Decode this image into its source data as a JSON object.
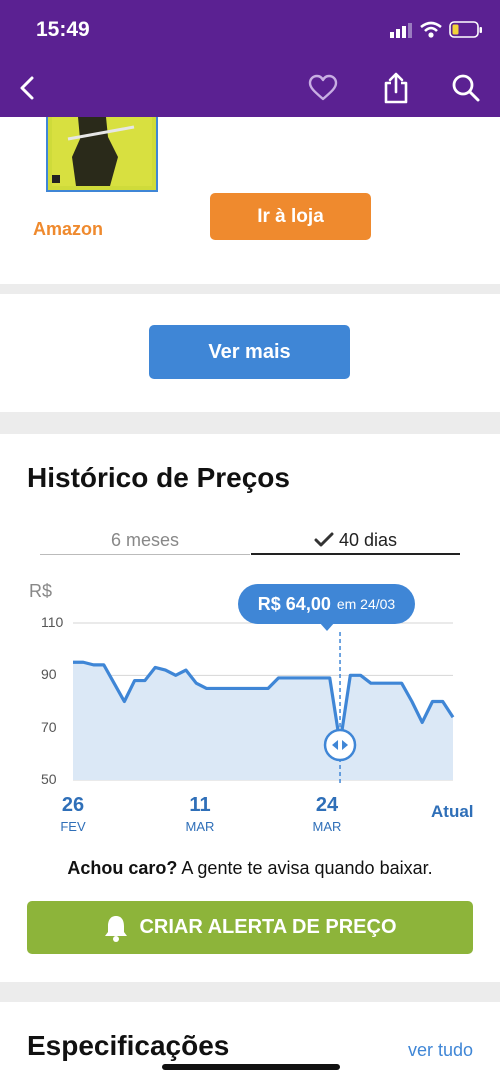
{
  "status_bar": {
    "time": "15:49"
  },
  "navbar": {
    "icons": [
      "back-icon",
      "heart-icon",
      "share-icon",
      "search-icon"
    ]
  },
  "store": {
    "name": "Amazon",
    "button_label": "Ir à loja"
  },
  "more": {
    "button_label": "Ver mais"
  },
  "history": {
    "title": "Histórico de Preços",
    "tabs": [
      {
        "label": "6 meses",
        "selected": false
      },
      {
        "label": "40 dias",
        "selected": true
      }
    ],
    "tooltip": {
      "price": "R$ 64,00",
      "date_text": "em 24/03"
    },
    "currency_label": "R$",
    "x_labels": [
      {
        "day": "26",
        "month": "FEV"
      },
      {
        "day": "11",
        "month": "MAR"
      },
      {
        "day": "24",
        "month": "MAR"
      },
      {
        "day": "Atual",
        "month": ""
      }
    ]
  },
  "chart_data": {
    "type": "area",
    "ylabel": "R$",
    "ylim": [
      50,
      110
    ],
    "yticks": [
      110,
      90,
      70,
      50
    ],
    "grid": true,
    "x": [
      "26/02",
      "27/02",
      "28/02",
      "01/03",
      "02/03",
      "03/03",
      "04/03",
      "05/03",
      "06/03",
      "07/03",
      "08/03",
      "09/03",
      "10/03",
      "11/03",
      "12/03",
      "13/03",
      "14/03",
      "15/03",
      "16/03",
      "17/03",
      "18/03",
      "19/03",
      "20/03",
      "21/03",
      "22/03",
      "23/03",
      "24/03",
      "25/03",
      "26/03",
      "27/03",
      "28/03",
      "29/03",
      "30/03",
      "31/03",
      "01/04",
      "02/04",
      "03/04",
      "04/04"
    ],
    "series": [
      {
        "values": [
          95,
          95,
          94,
          94,
          87,
          80,
          88,
          88,
          93,
          92,
          90,
          92,
          87,
          85,
          85,
          85,
          85,
          85,
          85,
          85,
          89,
          89,
          89,
          89,
          89,
          89,
          64,
          90,
          90,
          87,
          87,
          87,
          87,
          80,
          72,
          80,
          80,
          74
        ]
      }
    ],
    "highlight": {
      "x": "24/03",
      "value": 64
    }
  },
  "alert": {
    "bold": "Achou caro?",
    "rest": "A gente te avisa quando baixar.",
    "button_label": "CRIAR ALERTA DE PREÇO"
  },
  "specs": {
    "title": "Especificações",
    "link_label": "ver tudo"
  },
  "colors": {
    "header": "#5b2192",
    "store_button": "#ef8a2e",
    "amazon_text": "#ef8a2e",
    "primary_button": "#3f86d6",
    "alert_button": "#8db43a",
    "chart_line": "#3f86d6",
    "chart_fill": "#dbe8f6"
  }
}
